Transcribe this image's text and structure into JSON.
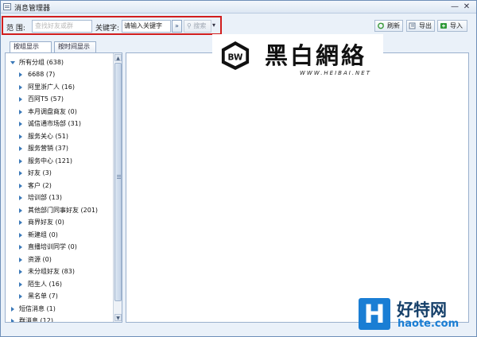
{
  "window": {
    "title": "消息管理器",
    "minimize_label": "—",
    "close_label": "✕"
  },
  "toolbar": {
    "range_label": "范 围:",
    "range_placeholder": "查找好友或群",
    "keyword_label": "关键字:",
    "keyword_value": "请输入关键字",
    "more_label": "»",
    "search_label": "搜索",
    "dropdown_label": "▾",
    "refresh_label": "刷新",
    "export_label": "导出",
    "import_label": "导入"
  },
  "tabs": [
    {
      "label": "按组显示",
      "active": true
    },
    {
      "label": "按时间显示",
      "active": false
    }
  ],
  "tree": {
    "root": "所有分组 (638)",
    "groups": [
      "6688 (7)",
      "阿里浙广人 (16)",
      "百阿T5 (57)",
      "本月调盘商友 (0)",
      "诚信通市场部 (31)",
      "服务关心 (51)",
      "服务营销 (37)",
      "服务中心 (121)",
      "好友 (3)",
      "客户 (2)",
      "培训部 (13)",
      "其他部门同事好友 (201)",
      "商界好友 (0)",
      "新建组 (0)",
      "直播培训同学 (0)",
      "资源 (0)",
      "未分组好友 (83)",
      "陌生人 (16)",
      "黑名单 (7)"
    ],
    "other": [
      "短信消息 (1)",
      "群消息 (12)"
    ]
  },
  "watermark": {
    "text": "黑白網絡",
    "url": "WWW.HEIBAI.NET"
  },
  "site_logo": {
    "letter": "H",
    "name": "好特网",
    "url": "haote.com"
  }
}
